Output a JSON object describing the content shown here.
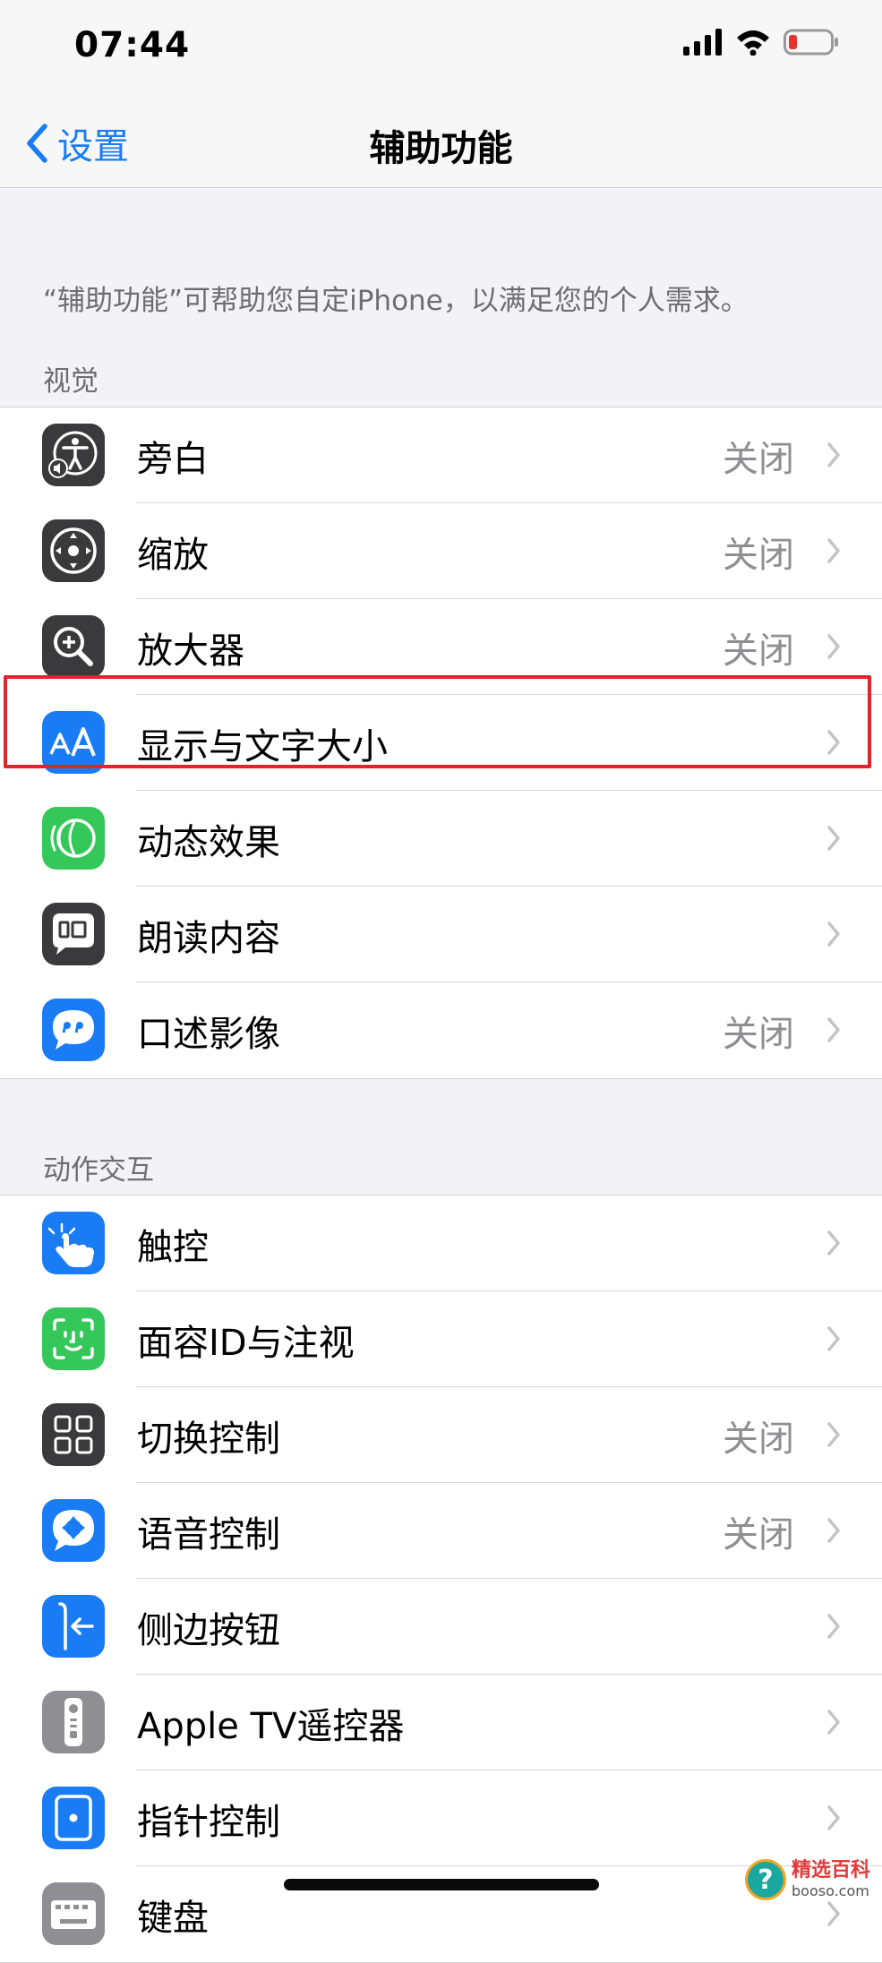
{
  "status_bar": {
    "time": "07:44"
  },
  "nav": {
    "back_label": "设置",
    "title": "辅助功能"
  },
  "intro": "“辅助功能”可帮助您自定iPhone，以满足您的个人需求。",
  "sections": [
    {
      "header": "视觉",
      "items": [
        {
          "label": "旁白",
          "value": "关闭",
          "icon": "voiceover-icon"
        },
        {
          "label": "缩放",
          "value": "关闭",
          "icon": "zoom-icon"
        },
        {
          "label": "放大器",
          "value": "关闭",
          "icon": "magnifier-icon"
        },
        {
          "label": "显示与文字大小",
          "value": "",
          "icon": "text-size-icon"
        },
        {
          "label": "动态效果",
          "value": "",
          "icon": "motion-icon"
        },
        {
          "label": "朗读内容",
          "value": "",
          "icon": "spoken-content-icon"
        },
        {
          "label": "口述影像",
          "value": "关闭",
          "icon": "audio-descriptions-icon"
        }
      ]
    },
    {
      "header": "动作交互",
      "items": [
        {
          "label": "触控",
          "value": "",
          "icon": "touch-icon"
        },
        {
          "label": "面容ID与注视",
          "value": "",
          "icon": "face-id-icon"
        },
        {
          "label": "切换控制",
          "value": "关闭",
          "icon": "switch-control-icon"
        },
        {
          "label": "语音控制",
          "value": "关闭",
          "icon": "voice-control-icon"
        },
        {
          "label": "侧边按钮",
          "value": "",
          "icon": "side-button-icon"
        },
        {
          "label": "Apple TV遥控器",
          "value": "",
          "icon": "apple-tv-remote-icon"
        },
        {
          "label": "指针控制",
          "value": "",
          "icon": "pointer-control-icon"
        },
        {
          "label": "键盘",
          "value": "",
          "icon": "keyboard-icon"
        }
      ]
    }
  ],
  "watermark": {
    "text": "精选百科",
    "sub": "booso.com"
  },
  "colors": {
    "accent": "#1a7cf5",
    "highlight": "#e0242b",
    "group_bg": "#ffffff",
    "page_bg": "#f2f2f7"
  }
}
